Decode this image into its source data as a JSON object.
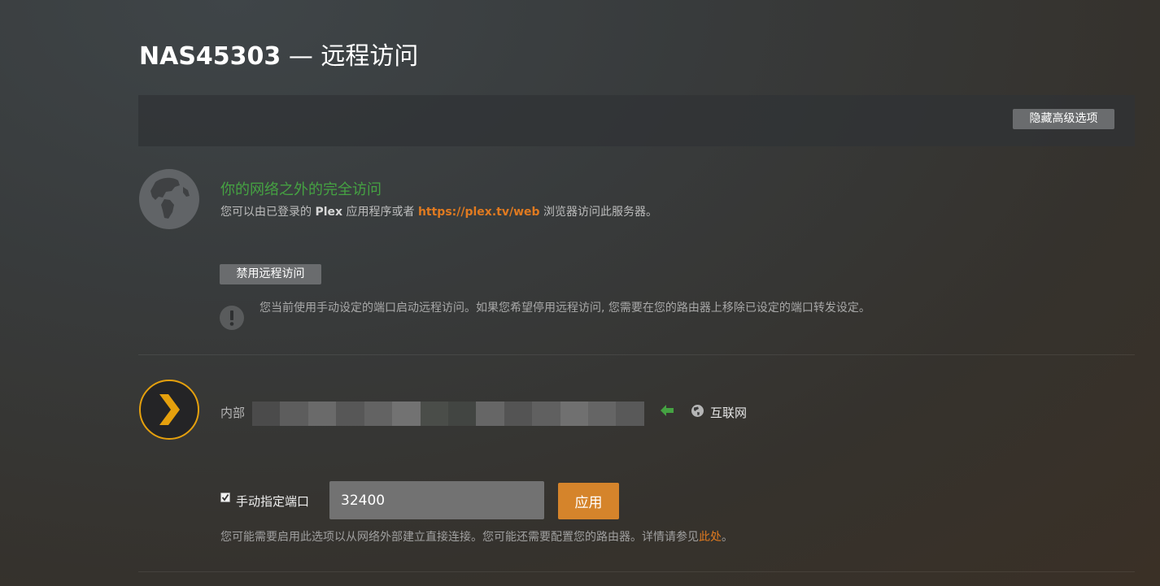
{
  "header": {
    "server_name": "NAS45303",
    "separator": "—",
    "section": "远程访问"
  },
  "toolbar": {
    "hide_advanced_label": "隐藏高级选项"
  },
  "status": {
    "icon": "globe-icon",
    "title": "你的网络之外的完全访问",
    "desc_prefix": "您可以由已登录的",
    "desc_brand": "Plex",
    "desc_middle": "应用程序或者",
    "desc_link": "https://plex.tv/web",
    "desc_suffix": "浏览器访问此服务器。",
    "title_color": "#45a242",
    "link_color": "#e07a20"
  },
  "actions": {
    "disable_label": "禁用远程访问"
  },
  "warning": {
    "icon": "exclamation-icon",
    "text": "您当前使用手动设定的端口启动远程访问。如果您希望停用远程访问, 您需要在您的路由器上移除已设定的端口转发设定。"
  },
  "mapping": {
    "logo_icon": "plex-logo-icon",
    "internal_label": "内部",
    "arrow_icon": "arrow-left-icon",
    "arrow_color": "#45a242",
    "network_icon": "globe-icon",
    "internet_label": "互联网"
  },
  "port": {
    "checkbox_checked": true,
    "checkbox_label": "手动指定端口",
    "value": "32400",
    "apply_label": "应用",
    "accent_color": "#d5842b"
  },
  "help": {
    "text_prefix": "您可能需要启用此选项以从网络外部建立直接连接。您可能还需要配置您的路由器。详情请参见",
    "link_text": "此处",
    "text_suffix": "。"
  }
}
